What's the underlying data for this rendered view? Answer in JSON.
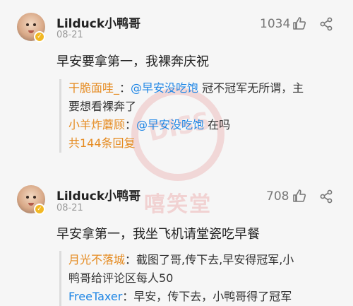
{
  "comments": [
    {
      "username": "Lilduck小鸭哥",
      "date": "08-21",
      "likes": "1034",
      "body": "早安要拿第一，我裸奔庆祝",
      "replies": [
        {
          "name": "干脆面哇_",
          "sep": "：",
          "mention": "@早安没吃饱",
          "text": " 冠不冠军无所谓，主",
          "text2": "要想看裸奔了"
        },
        {
          "name": "小羊炸蘑顾",
          "sep": "：",
          "mention": "@早安没吃饱",
          "text": " 在吗"
        }
      ],
      "more_replies": "共144条回复"
    },
    {
      "username": "Lilduck小鸭哥",
      "date": "08-21",
      "likes": "708",
      "body": "早安拿第一，我坐飞机请堂瓷吃早餐",
      "replies": [
        {
          "name": "月光不落城",
          "sep": "：",
          "text": "截图了哥,传下去,早安得冠军,小",
          "text2": "鸭哥给评论区每人50"
        },
        {
          "name": "FreeTaxer",
          "sep": "：",
          "text": "早安，传下去，小鸭哥得了冠军"
        }
      ]
    }
  ],
  "watermark": {
    "top": "DISS",
    "bottom": "嘻笑堂"
  },
  "colors": {
    "accent_name": "#e58a1f",
    "mention": "#1f86e5",
    "badge": "#f2b824"
  }
}
